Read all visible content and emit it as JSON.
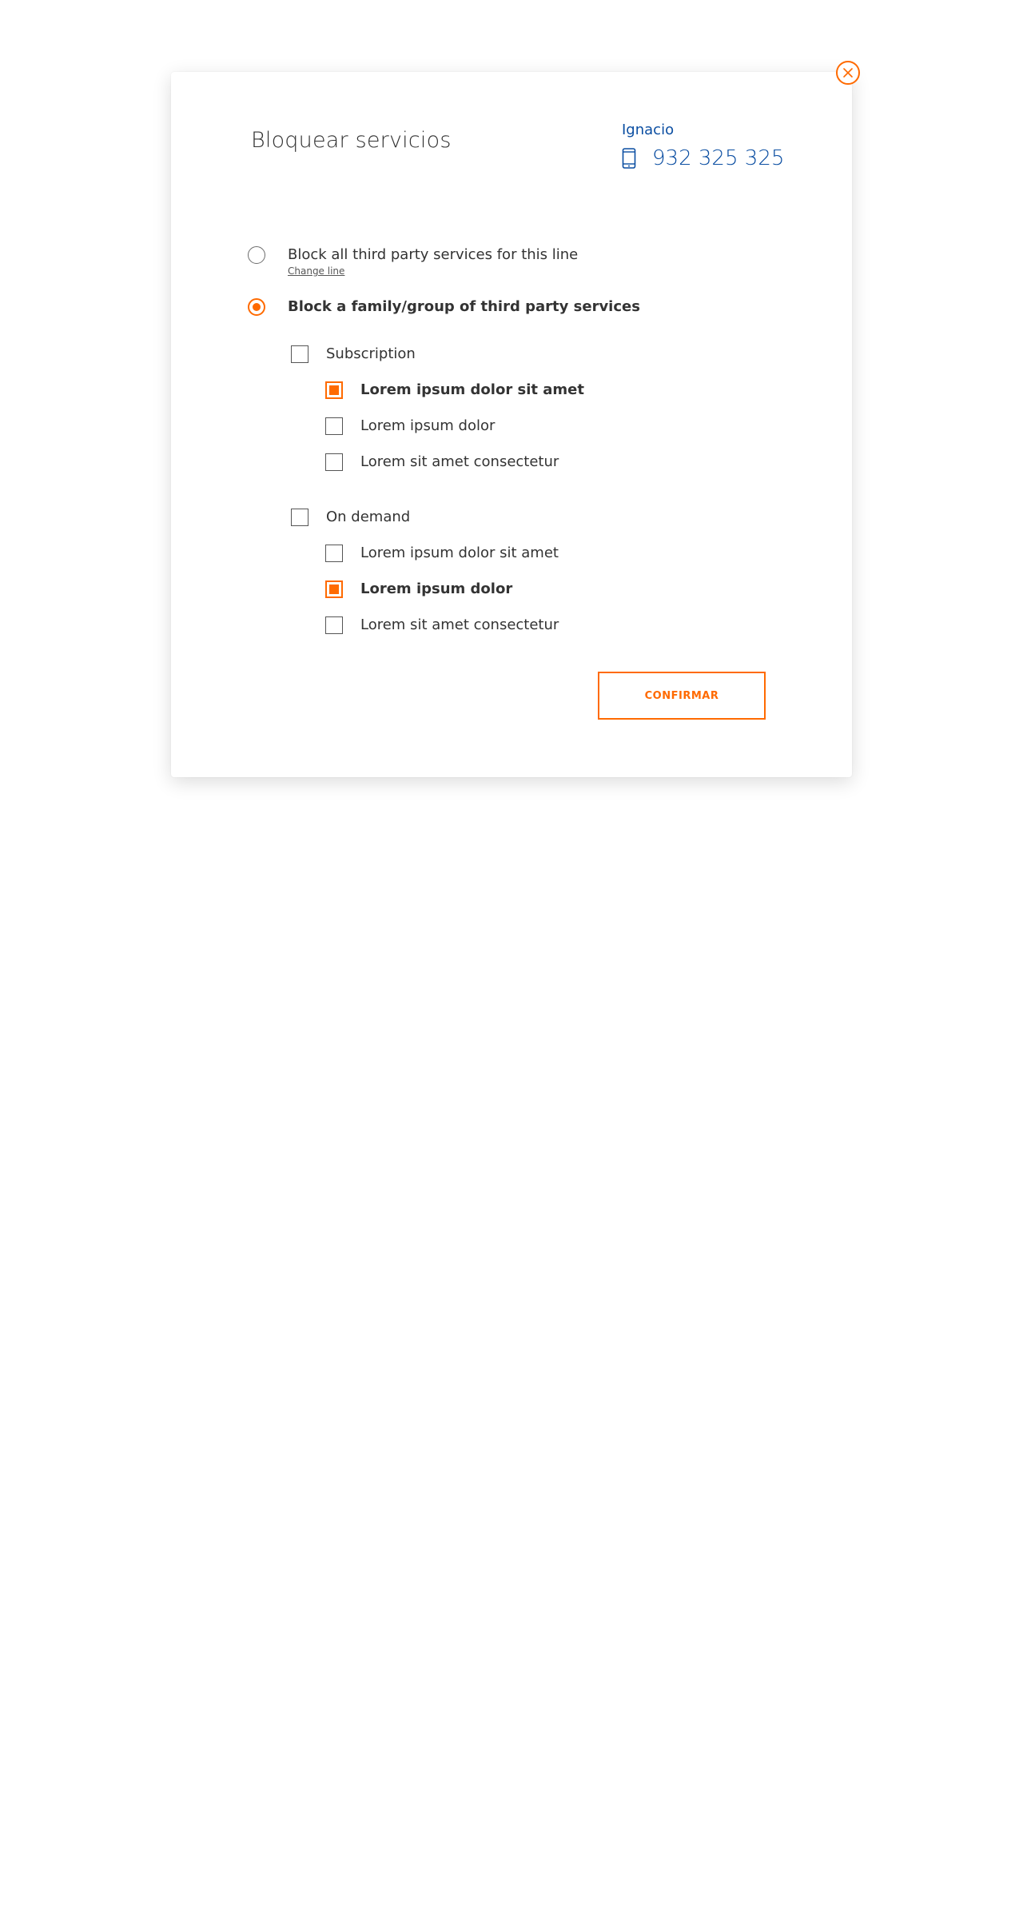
{
  "modal": {
    "title": "Bloquear servicios",
    "close_icon": "close-icon",
    "user": {
      "name": "Ignacio",
      "phone_icon": "mobile-phone-icon",
      "phone": "932 325 325"
    },
    "options": [
      {
        "label": "Block all third party services for this line",
        "sublink": "Change line",
        "selected": false
      },
      {
        "label": "Block a family/group of third party services",
        "selected": true
      }
    ],
    "groups": [
      {
        "label": "Subscription",
        "checked": false,
        "items": [
          {
            "label": "Lorem ipsum dolor sit amet",
            "checked": true
          },
          {
            "label": "Lorem ipsum dolor",
            "checked": false
          },
          {
            "label": "Lorem sit amet consectetur",
            "checked": false
          }
        ]
      },
      {
        "label": "On demand",
        "checked": false,
        "items": [
          {
            "label": "Lorem ipsum dolor sit amet",
            "checked": false
          },
          {
            "label": "Lorem ipsum dolor",
            "checked": true
          },
          {
            "label": "Lorem sit amet consectetur",
            "checked": false
          }
        ]
      }
    ],
    "confirm_label": "CONFIRMAR"
  },
  "colors": {
    "accent": "#ff6a00",
    "brand_blue": "#0b4ea2",
    "text": "#333333"
  }
}
